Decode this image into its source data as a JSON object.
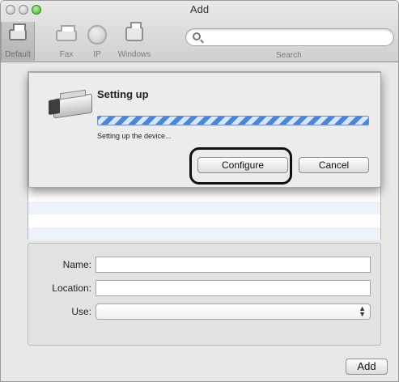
{
  "window": {
    "title": "Add"
  },
  "toolbar": {
    "buttons": [
      {
        "label": "Default",
        "icon": "default-printer-icon"
      },
      {
        "label": "Fax",
        "icon": "fax-icon"
      },
      {
        "label": "IP",
        "icon": "globe-icon"
      },
      {
        "label": "Windows",
        "icon": "windows-printer-icon"
      }
    ],
    "search": {
      "placeholder": "",
      "label": "Search"
    }
  },
  "sheet": {
    "title": "Setting up",
    "status": "Setting up the device...",
    "configure_label": "Configure",
    "cancel_label": "Cancel"
  },
  "form": {
    "name_label": "Name:",
    "location_label": "Location:",
    "use_label": "Use:",
    "name_value": "",
    "location_value": "",
    "use_value": ""
  },
  "add_label": "Add"
}
